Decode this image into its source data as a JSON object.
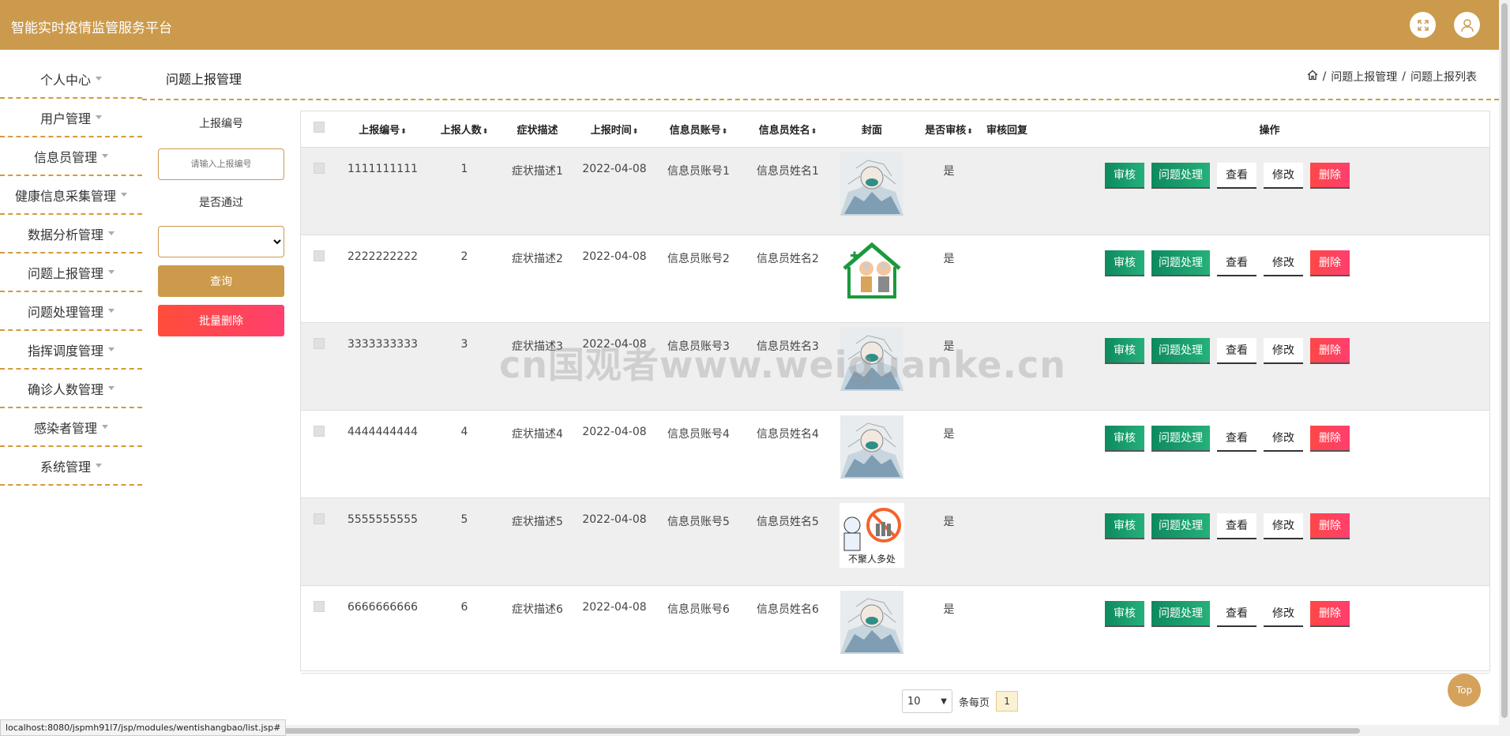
{
  "header": {
    "title": "智能实时疫情监管服务平台"
  },
  "sidebar": {
    "items": [
      {
        "label": "个人中心"
      },
      {
        "label": "用户管理"
      },
      {
        "label": "信息员管理"
      },
      {
        "label": "健康信息采集管理"
      },
      {
        "label": "数据分析管理"
      },
      {
        "label": "问题上报管理"
      },
      {
        "label": "问题处理管理"
      },
      {
        "label": "指挥调度管理"
      },
      {
        "label": "确诊人数管理"
      },
      {
        "label": "感染者管理"
      },
      {
        "label": "系统管理"
      }
    ]
  },
  "page": {
    "title": "问题上报管理",
    "breadcrumb": [
      "问题上报管理",
      "问题上报列表"
    ],
    "breadcrumb_sep": "/"
  },
  "filters": {
    "report_no_label": "上报编号",
    "report_no_placeholder": "请输入上报编号",
    "passed_label": "是否通过",
    "query_button": "查询",
    "batch_delete_button": "批量删除"
  },
  "table": {
    "columns": [
      "上报编号",
      "上报人数",
      "症状描述",
      "上报时间",
      "信息员账号",
      "信息员姓名",
      "封面",
      "是否审核",
      "审核回复",
      "操作"
    ],
    "rows": [
      {
        "no": "1111111111",
        "count": "1",
        "symptom": "症状描述1",
        "time": "2022-04-08",
        "account": "信息员账号1",
        "name": "信息员姓名1",
        "cover": "doctor-illustration",
        "reviewed": "是",
        "reply": ""
      },
      {
        "no": "2222222222",
        "count": "2",
        "symptom": "症状描述2",
        "time": "2022-04-08",
        "account": "信息员账号2",
        "name": "信息员姓名2",
        "cover": "elderly-house-illustration",
        "reviewed": "是",
        "reply": ""
      },
      {
        "no": "3333333333",
        "count": "3",
        "symptom": "症状描述3",
        "time": "2022-04-08",
        "account": "信息员账号3",
        "name": "信息员姓名3",
        "cover": "doctor-illustration",
        "reviewed": "是",
        "reply": ""
      },
      {
        "no": "4444444444",
        "count": "4",
        "symptom": "症状描述4",
        "time": "2022-04-08",
        "account": "信息员账号4",
        "name": "信息员姓名4",
        "cover": "doctor-illustration",
        "reviewed": "是",
        "reply": ""
      },
      {
        "no": "5555555555",
        "count": "5",
        "symptom": "症状描述5",
        "time": "2022-04-08",
        "account": "信息员账号5",
        "name": "信息员姓名5",
        "cover": "no-gathering-illustration",
        "reviewed": "是",
        "reply": ""
      },
      {
        "no": "6666666666",
        "count": "6",
        "symptom": "症状描述6",
        "time": "2022-04-08",
        "account": "信息员账号6",
        "name": "信息员姓名6",
        "cover": "doctor-illustration",
        "reviewed": "是",
        "reply": ""
      }
    ],
    "actions": [
      "审核",
      "问题处理",
      "查看",
      "修改",
      "删除"
    ],
    "cover_caption_no_gathering": "不聚人多处"
  },
  "pager": {
    "page_size": "10",
    "per_page_label": "条每页",
    "current_page": "1"
  },
  "top_button": "Top",
  "status_url": "localhost:8080/jspmh91l7/jsp/modules/wentishangbao/list.jsp#",
  "watermark": "cn国观者www.weiguanke.cn",
  "colors": {
    "brand": "#cc9a4c",
    "green": "#129167",
    "red": "#ff4747"
  }
}
